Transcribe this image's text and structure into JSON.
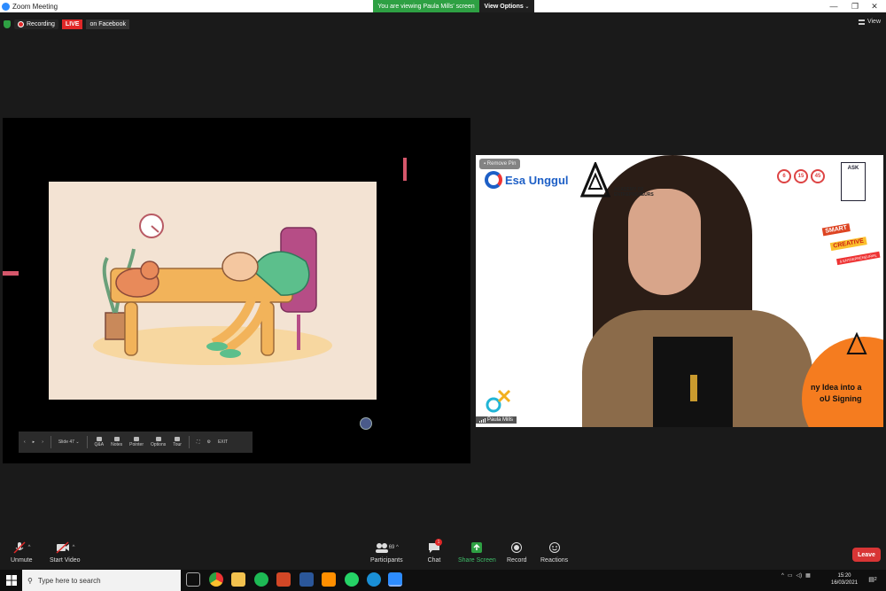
{
  "window": {
    "title": "Zoom Meeting"
  },
  "share_banner": {
    "text": "You are viewing Paula Mills' screen",
    "view_options": "View Options"
  },
  "status": {
    "recording": "Recording",
    "live": "LIVE",
    "on_facebook": "on Facebook"
  },
  "view_button": {
    "label": "View"
  },
  "slide_controls": {
    "slide_label": "Slide 47",
    "items": [
      "Q&A",
      "Notes",
      "Pointer",
      "Options",
      "Tour"
    ],
    "exit": "EXIT"
  },
  "video": {
    "remove_pin": "Remove Pin",
    "participant_name": "Paula Mills",
    "brand_esa": "Esa Unggul",
    "academy_lines": [
      "ACADEMY OF",
      "ENTREPRENEURS"
    ],
    "badges": [
      "6",
      "15",
      "45"
    ],
    "ask": "ASK",
    "smart_lines": [
      "SMART",
      "CREATIVE",
      "& ENTREPRENEURIAL"
    ],
    "idea_lines": [
      "ny Idea into a",
      "oU Signing"
    ]
  },
  "toolbar": {
    "unmute": "Unmute",
    "start_video": "Start Video",
    "participants": "Participants",
    "participants_count": "69",
    "chat": "Chat",
    "chat_badge": "1",
    "share_screen": "Share Screen",
    "record": "Record",
    "reactions": "Reactions",
    "leave": "Leave"
  },
  "taskbar": {
    "search_placeholder": "Type here to search",
    "time": "15:20",
    "date": "16/03/2021",
    "notifications": "2"
  },
  "colors": {
    "zoom_blue": "#2d8cff",
    "share_green": "#2ea043",
    "leave_red": "#d83535",
    "live_red": "#e02828"
  }
}
